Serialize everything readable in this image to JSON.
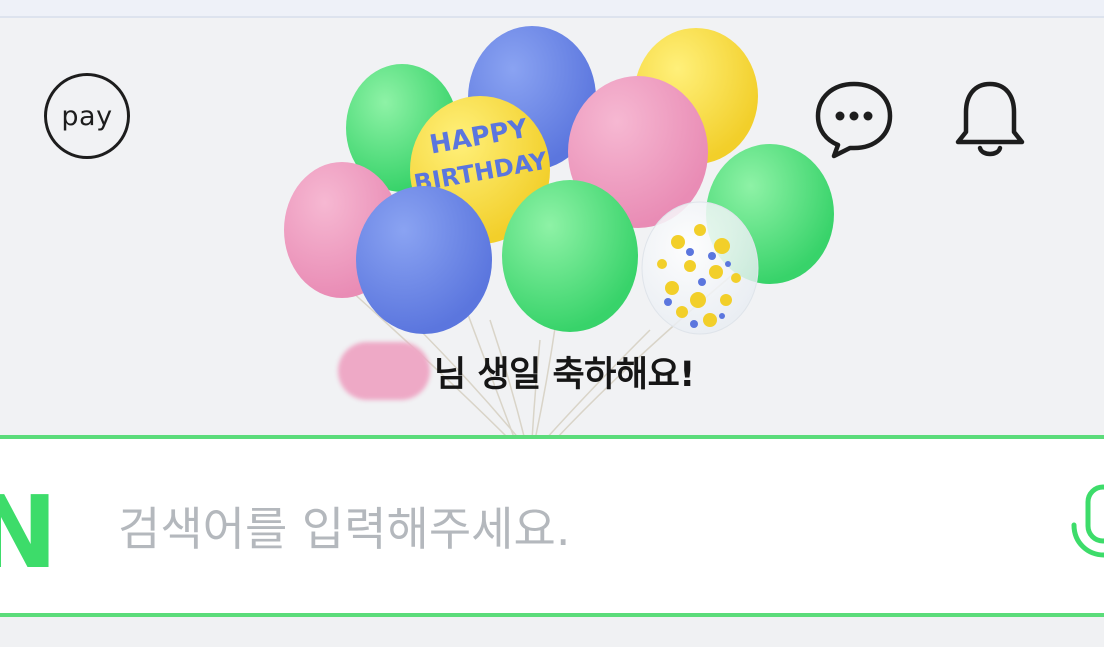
{
  "header": {
    "pay_label": "pay",
    "greeting_suffix": "님 생일 축하해요!",
    "balloon_text_line1": "HAPPY",
    "balloon_text_line2": "BIRTHDAY"
  },
  "icons": {
    "chat": "chat-bubble-dots-icon",
    "bell": "bell-icon",
    "mic": "microphone-icon"
  },
  "search": {
    "logo": "N",
    "placeholder": "검색어를 입력해주세요.",
    "value": ""
  },
  "colors": {
    "brand_green": "#3ddc6a",
    "border_green": "#5bdc7a",
    "placeholder_gray": "#b4b8bd",
    "name_blur_pink": "#eea9c6"
  }
}
